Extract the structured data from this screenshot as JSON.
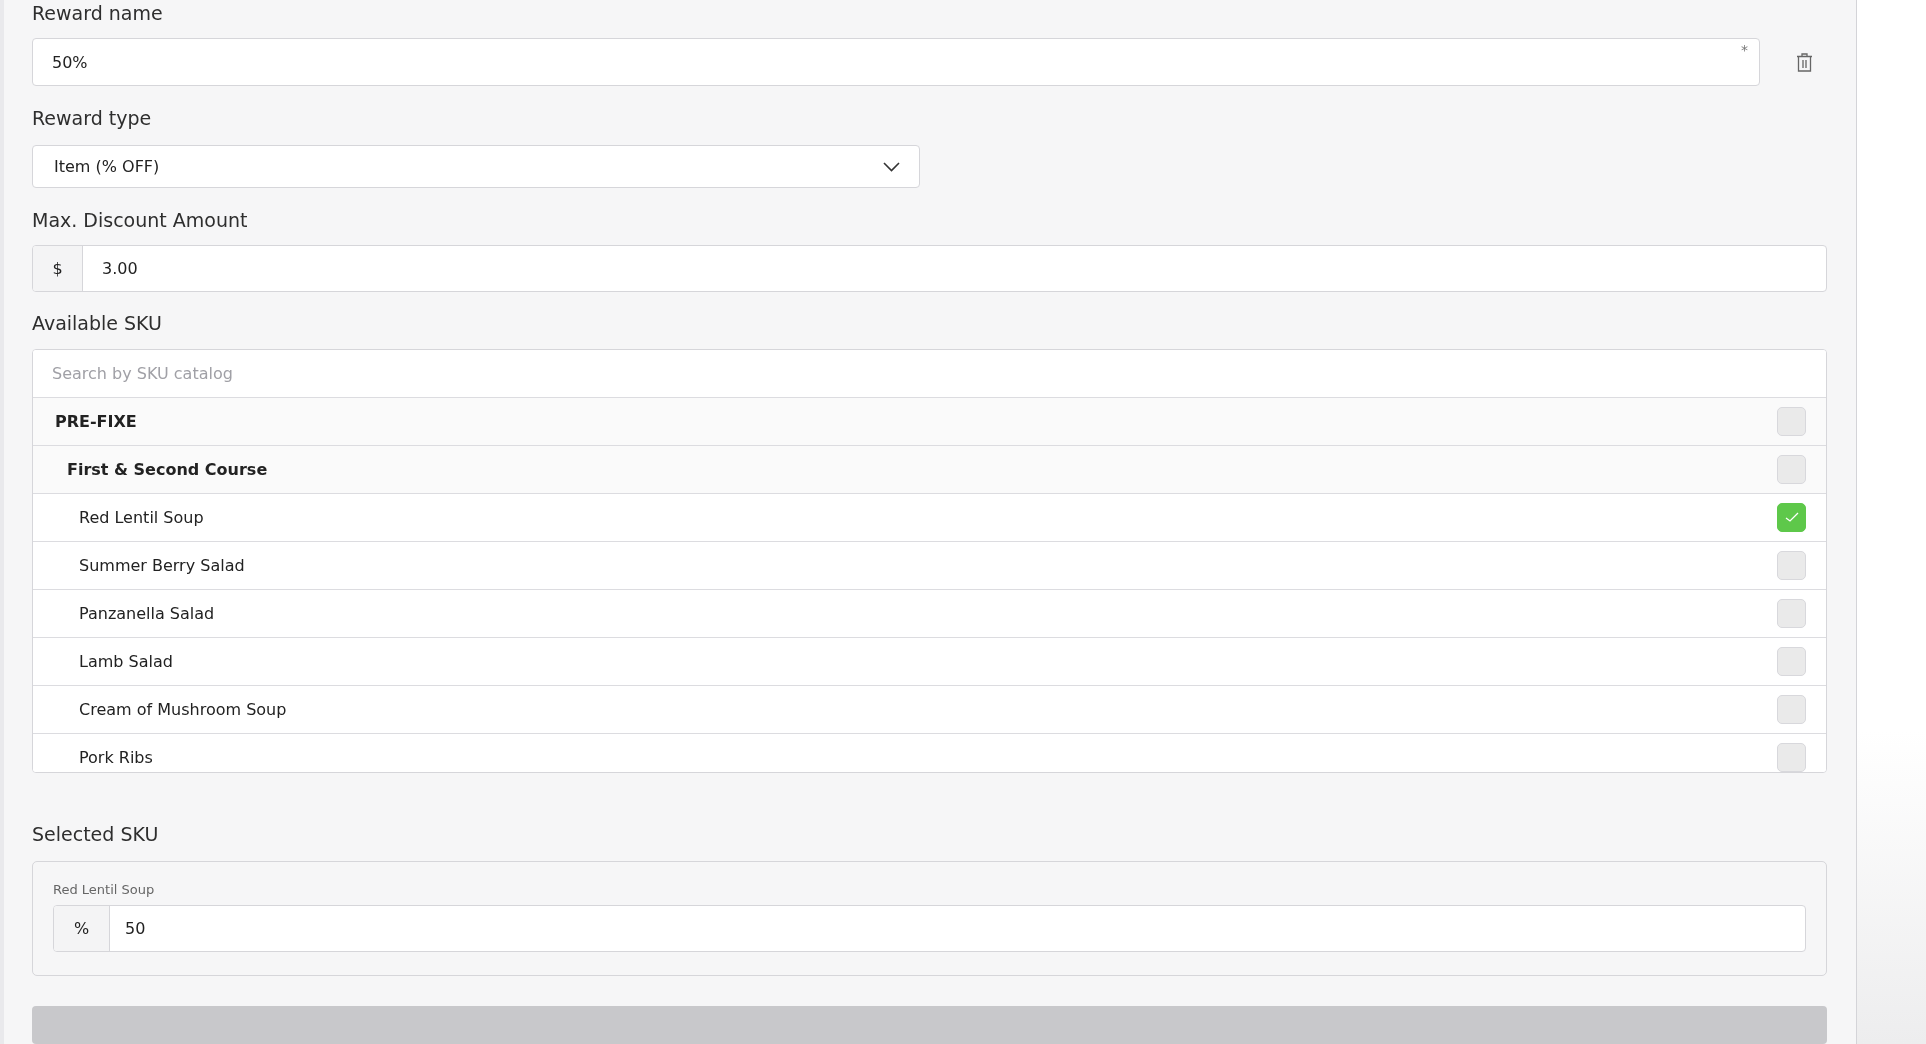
{
  "reward_name": {
    "label": "Reward name",
    "value": "50%",
    "required_mark": "*"
  },
  "reward_type": {
    "label": "Reward type",
    "value": "Item (% OFF)"
  },
  "max_discount": {
    "label": "Max. Discount Amount",
    "prefix": "$",
    "value": "3.00"
  },
  "available_sku": {
    "label": "Available SKU",
    "search": {
      "placeholder": "Search by SKU catalog"
    },
    "tree": [
      {
        "name": "PRE-FIXE",
        "checked": false,
        "children": [
          {
            "name": "First & Second Course",
            "checked": false,
            "children": [
              {
                "name": "Red Lentil Soup",
                "checked": true
              },
              {
                "name": "Summer Berry Salad",
                "checked": false
              },
              {
                "name": "Panzanella Salad",
                "checked": false
              },
              {
                "name": "Lamb Salad",
                "checked": false
              },
              {
                "name": "Cream of Mushroom Soup",
                "checked": false
              },
              {
                "name": "Pork Ribs",
                "checked": false
              }
            ]
          }
        ]
      }
    ]
  },
  "selected_sku": {
    "label": "Selected SKU",
    "items": [
      {
        "name": "Red Lentil Soup",
        "prefix": "%",
        "value": "50"
      }
    ]
  }
}
